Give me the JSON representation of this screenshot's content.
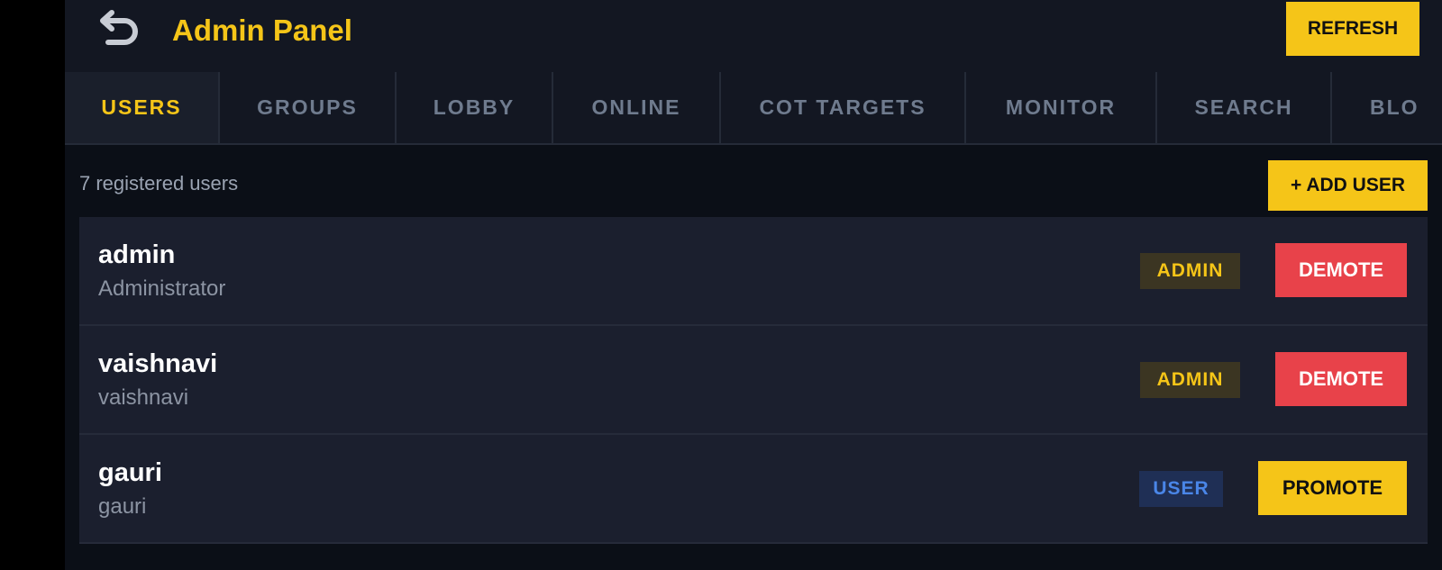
{
  "header": {
    "back_icon": "undo-arrow-icon",
    "title": "Admin Panel",
    "refresh_label": "REFRESH"
  },
  "tabs": [
    {
      "label": "USERS",
      "active": true
    },
    {
      "label": "GROUPS",
      "active": false
    },
    {
      "label": "LOBBY",
      "active": false
    },
    {
      "label": "ONLINE",
      "active": false
    },
    {
      "label": "COT TARGETS",
      "active": false
    },
    {
      "label": "MONITOR",
      "active": false
    },
    {
      "label": "SEARCH",
      "active": false
    },
    {
      "label": "BLO",
      "active": false
    }
  ],
  "toolbar": {
    "count_text": "7 registered users",
    "add_user_label": "+ ADD USER"
  },
  "users": [
    {
      "username": "admin",
      "display_name": "Administrator",
      "role": "ADMIN",
      "action": "DEMOTE"
    },
    {
      "username": "vaishnavi",
      "display_name": "vaishnavi",
      "role": "ADMIN",
      "action": "DEMOTE"
    },
    {
      "username": "gauri",
      "display_name": "gauri",
      "role": "USER",
      "action": "PROMOTE"
    }
  ],
  "colors": {
    "accent": "#f5c518",
    "danger": "#e8424a",
    "user_blue": "#4a86e8",
    "background": "#0b0f17",
    "panel": "#131722"
  }
}
